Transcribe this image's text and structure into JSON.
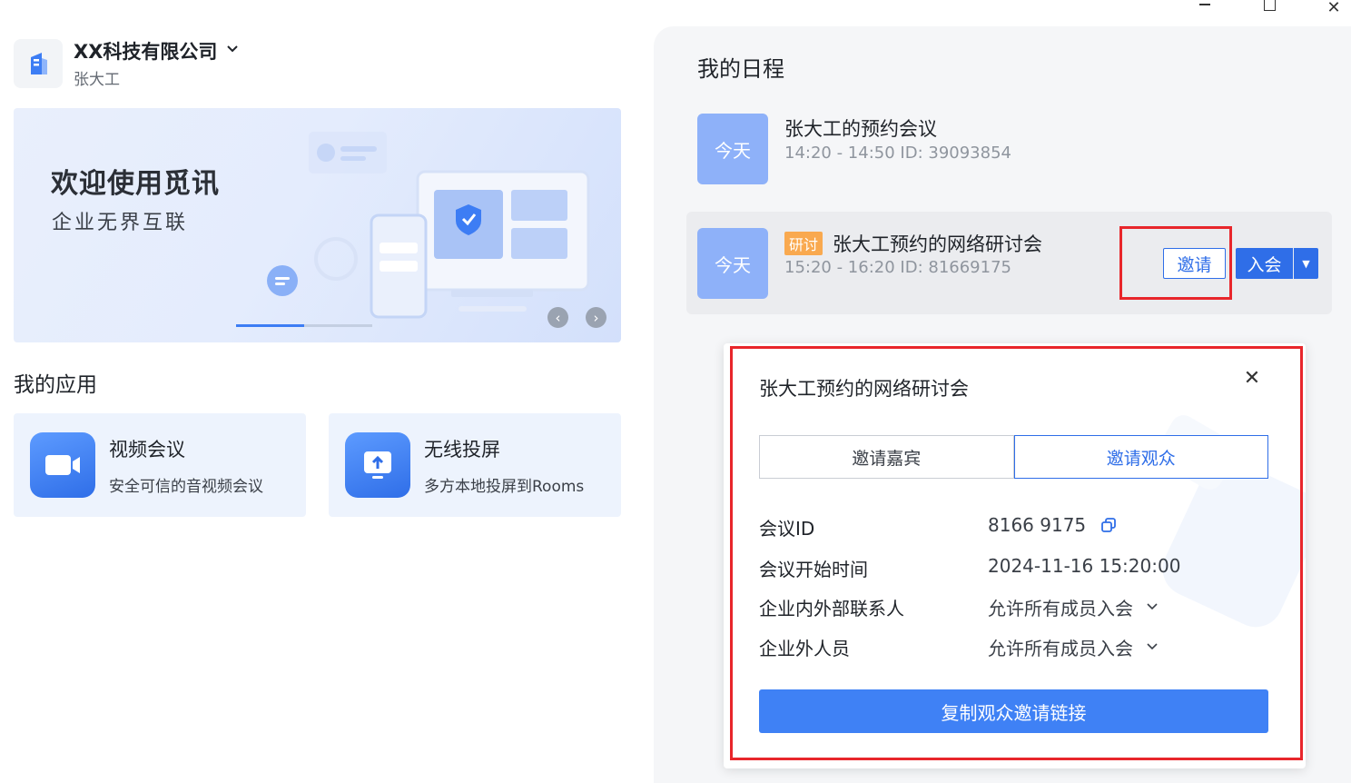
{
  "window": {
    "minimize": "—",
    "maximize": "□",
    "close": "✕"
  },
  "org": {
    "name": "XX科技有限公司",
    "chevron": "⌄",
    "user": "张大工"
  },
  "banner": {
    "title": "欢迎使用觅讯",
    "subtitle": "企业无界互联",
    "prev": "‹",
    "next": "›"
  },
  "apps": {
    "title": "我的应用",
    "items": [
      {
        "name": "视频会议",
        "desc": "安全可信的音视频会议",
        "icon": "video-camera-icon"
      },
      {
        "name": "无线投屏",
        "desc": "多方本地投屏到Rooms",
        "icon": "screen-cast-icon"
      }
    ]
  },
  "schedule": {
    "title": "我的日程",
    "items": [
      {
        "day": "今天",
        "title": "张大工的预约会议",
        "meta": "14:20 - 14:50   ID: 39093854"
      },
      {
        "day": "今天",
        "tag": "研讨",
        "title": "张大工预约的网络研讨会",
        "meta": "15:20 - 16:20   ID: 81669175",
        "invite": "邀请",
        "join": "入会",
        "join_drop": "▼"
      }
    ]
  },
  "popup": {
    "title": "张大工预约的网络研讨会",
    "close": "✕",
    "tabs": [
      "邀请嘉宾",
      "邀请观众"
    ],
    "active_tab": 1,
    "rows": [
      {
        "label": "会议ID",
        "value": "8166 9175"
      },
      {
        "label": "会议开始时间",
        "value": "2024-11-16 15:20:00"
      },
      {
        "label": "企业内外部联系人",
        "value": "允许所有成员入会"
      },
      {
        "label": "企业外人员",
        "value": "允许所有成员入会"
      }
    ],
    "chevron": "⌄",
    "copy_button": "复制观众邀请链接"
  },
  "colors": {
    "accent": "#2f6ee8",
    "highlight": "#e8262b",
    "tag": "#f9a94f",
    "today": "#8eb1f9"
  }
}
